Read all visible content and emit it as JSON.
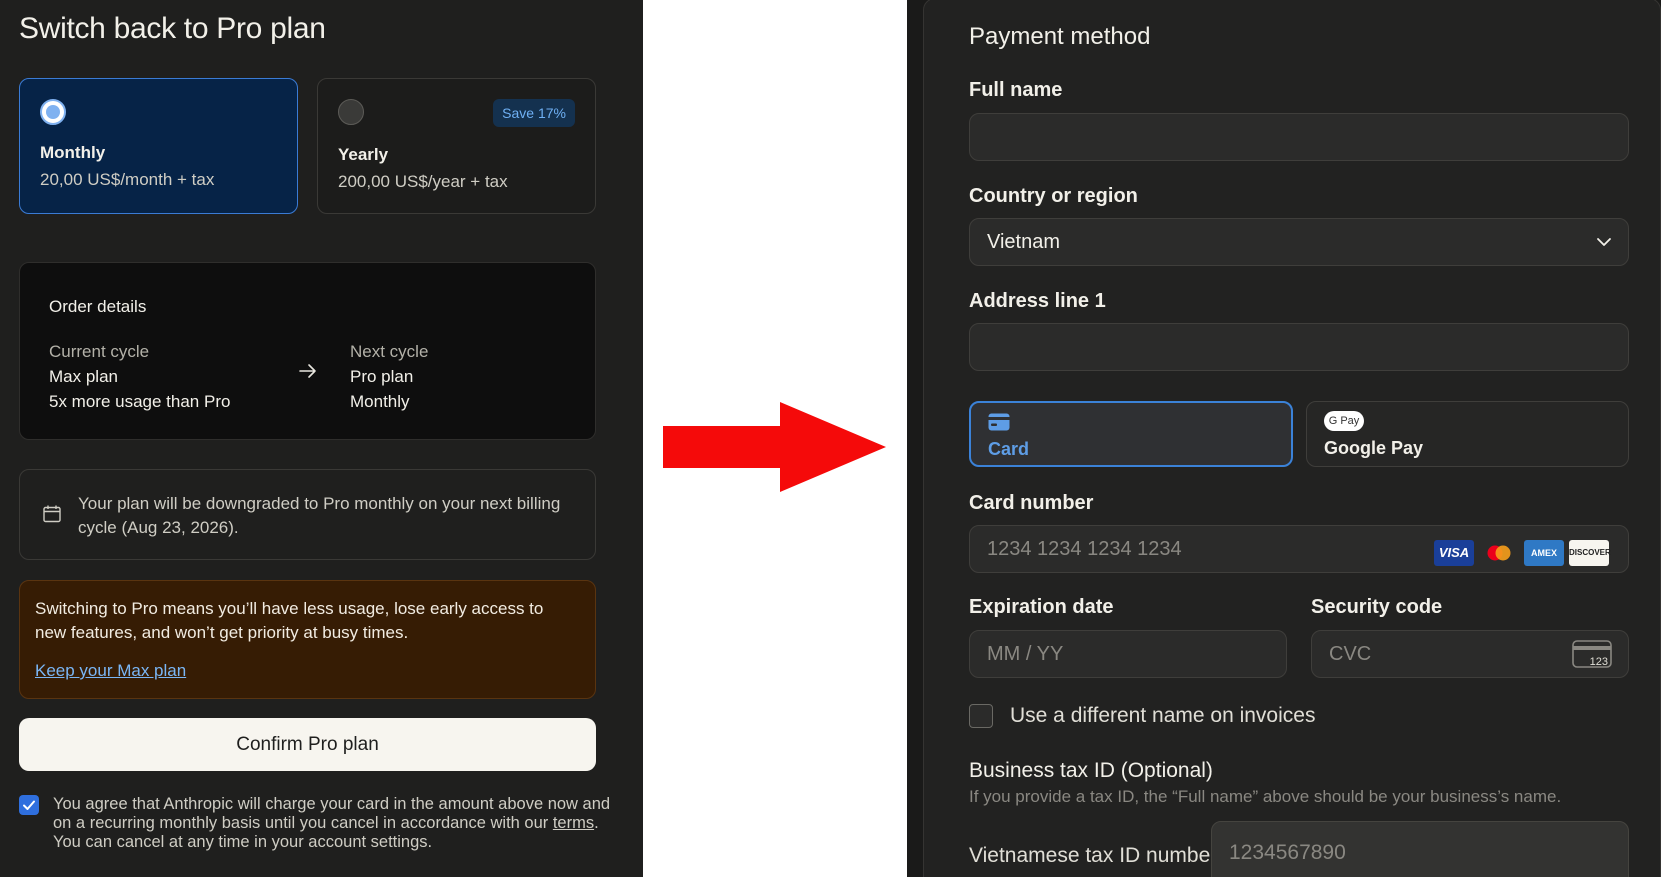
{
  "left": {
    "title": "Switch back to Pro plan",
    "plans": [
      {
        "name": "Monthly",
        "price": "20,00 US$/month + tax",
        "selected": true
      },
      {
        "name": "Yearly",
        "price": "200,00 US$/year + tax",
        "selected": false,
        "badge": "Save 17%"
      }
    ],
    "order": {
      "title": "Order details",
      "current_label": "Current cycle",
      "current_plan": "Max plan",
      "current_desc": "5x more usage than Pro",
      "next_label": "Next cycle",
      "next_plan": "Pro plan",
      "next_desc": "Monthly"
    },
    "info": "Your plan will be downgraded to Pro monthly on your next billing cycle (Aug 23, 2026).",
    "warning": {
      "text": "Switching to Pro means you’ll have less usage, lose early access to new features, and won’t get priority at busy times.",
      "link": "Keep your Max plan"
    },
    "confirm_label": "Confirm Pro plan",
    "agree": {
      "before": "You agree that Anthropic will charge your card in the amount above now and on a recurring monthly basis until you cancel in accordance with our ",
      "terms": "terms",
      "after": ". You can cancel at any time in your account settings.",
      "checked": true
    }
  },
  "right": {
    "title": "Payment method",
    "full_name_label": "Full name",
    "full_name_value": "",
    "country_label": "Country or region",
    "country_value": "Vietnam",
    "address_label": "Address line 1",
    "address_value": "",
    "pay_options": [
      {
        "label": "Card",
        "selected": true
      },
      {
        "label": "Google Pay",
        "selected": false,
        "icon_text": "G Pay"
      }
    ],
    "card_number_label": "Card number",
    "card_number_placeholder": "1234 1234 1234 1234",
    "card_brands": [
      "VISA",
      "Mastercard",
      "AMEX",
      "DISCOVER"
    ],
    "expiry_label": "Expiration date",
    "expiry_placeholder": "MM / YY",
    "cvc_label": "Security code",
    "cvc_placeholder": "CVC",
    "cvc_icon_text": "123",
    "different_name_label": "Use a different name on invoices",
    "tax_title": "Business tax ID (Optional)",
    "tax_hint": "If you provide a tax ID, the “Full name” above should be your business’s name.",
    "tax_label": "Vietnamese tax ID number",
    "tax_placeholder": "1234567890"
  },
  "colors": {
    "accent_blue": "#3b82d8",
    "arrow_red": "#f50a0a",
    "warning_bg": "#361c04",
    "selected_plan_bg": "#062347"
  }
}
